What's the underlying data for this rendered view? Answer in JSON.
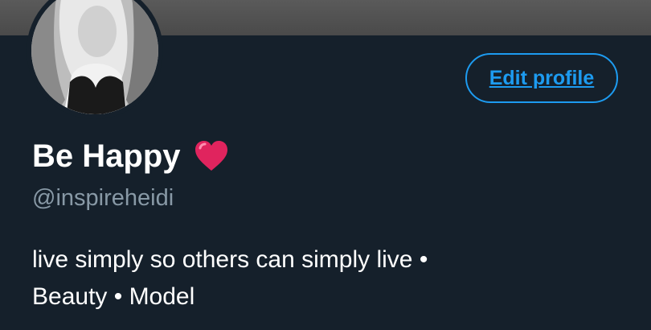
{
  "profile": {
    "display_name": "Be Happy",
    "emoji_icon": "red-heart-icon",
    "handle": "@inspireheidi",
    "bio_line1": "live simply so others can simply live •",
    "bio_line2": "Beauty • Model"
  },
  "actions": {
    "edit_profile_label": "Edit profile"
  },
  "colors": {
    "background": "#15202b",
    "accent": "#1d9bf0",
    "secondary_text": "#8899a6",
    "heart": "#e0245e"
  }
}
